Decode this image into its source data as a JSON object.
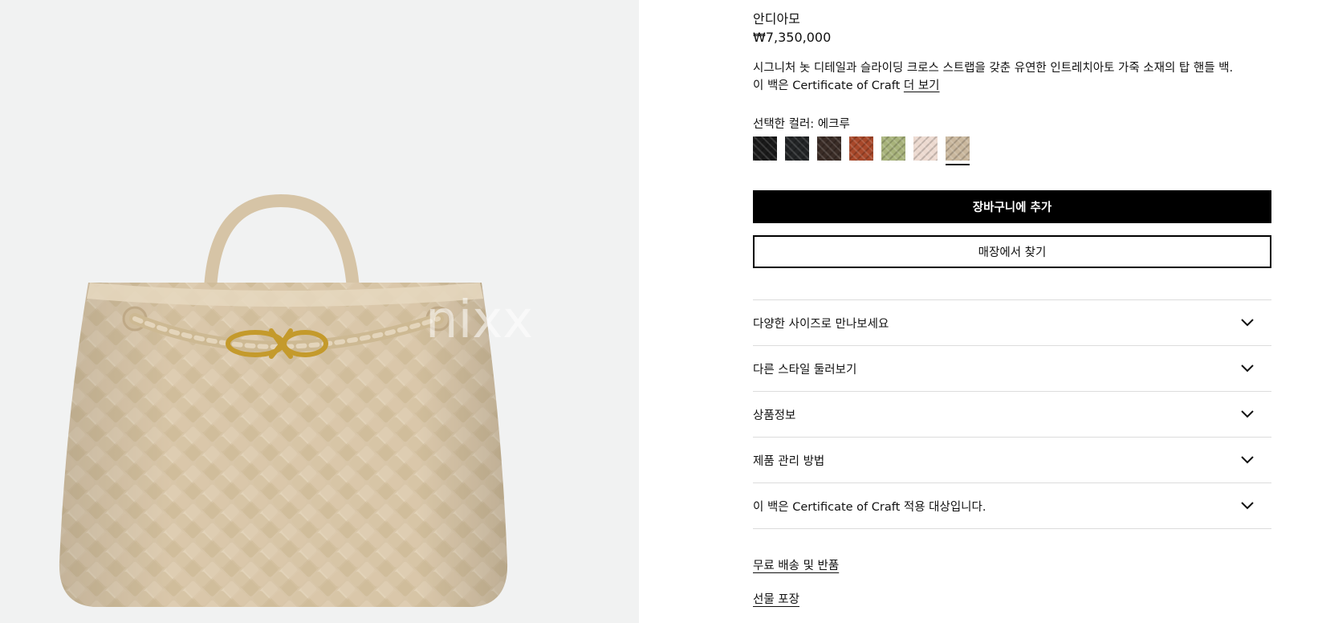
{
  "product": {
    "name": "안디아모",
    "price": "₩7,350,000",
    "description_line1": "시그니처 놋 디테일과 슬라이딩 크로스 스트랩을 갖춘 유연한 인트레치아토 가죽 소재의 탑 핸들 백.",
    "description_line2_prefix": "이 백은 Certificate of Craft ",
    "description_more_link": "더 보기",
    "selected_color_label": "선택한 컬러: 에크루"
  },
  "colors": [
    {
      "name": "black",
      "hex": "#1a1a1a"
    },
    {
      "name": "black-2",
      "hex": "#222426"
    },
    {
      "name": "dark-brown",
      "hex": "#3a2c26"
    },
    {
      "name": "rust",
      "hex": "#a8482a"
    },
    {
      "name": "sage",
      "hex": "#a7b27a"
    },
    {
      "name": "blush",
      "hex": "#ecd9cf"
    },
    {
      "name": "ecru",
      "hex": "#c9b79d",
      "selected": true
    }
  ],
  "actions": {
    "add_to_cart": "장바구니에 추가",
    "find_in_store": "매장에서 찾기"
  },
  "accordion": [
    {
      "label": "다양한 사이즈로 만나보세요"
    },
    {
      "label": "다른 스타일 둘러보기"
    },
    {
      "label": "상품정보"
    },
    {
      "label": "제품 관리 방법"
    },
    {
      "label": "이 백은 Certificate of Craft 적용 대상입니다."
    }
  ],
  "links": {
    "shipping": "무료 배송 및 반품",
    "gift_wrap": "선물 포장"
  },
  "image": {
    "watermark": "nixx",
    "bag_color": "#d9c8ad",
    "hardware_color": "#c9a13a"
  }
}
